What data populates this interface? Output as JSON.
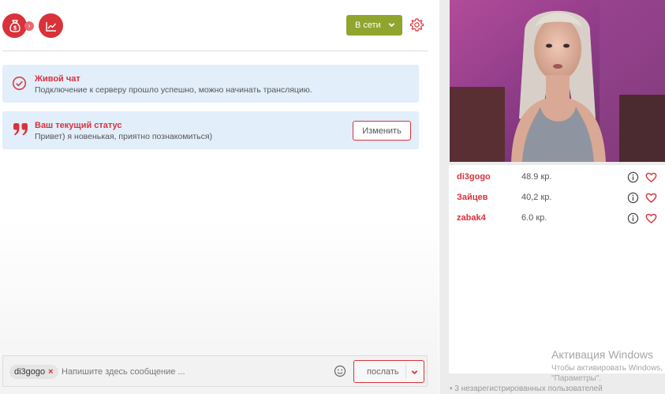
{
  "toolbar": {
    "earnings_icon": "money-bag-icon",
    "stats_icon": "trend-chart-icon",
    "status_select": {
      "value": "В сети"
    },
    "settings_icon": "gear-icon"
  },
  "notices": {
    "live_chat": {
      "title": "Живой чат",
      "text": "Подключение к серверу прошло успешно, можно начинать трансляцию."
    },
    "current_status": {
      "title": "Ваш текущий статус",
      "text": "Привет) я новенькая, приятно познакомиться)",
      "change_label": "Изменить"
    }
  },
  "composer": {
    "recipient_tag": "di3gogo",
    "placeholder": "Напишите здесь сообщение ...",
    "send_label": "послать"
  },
  "users": [
    {
      "name": "di3gogo",
      "credits": "48.9 кр."
    },
    {
      "name": "Зайцев",
      "credits": "40,2 кр."
    },
    {
      "name": "zabak4",
      "credits": "6.0 кр."
    }
  ],
  "footer": {
    "unregistered": "• 3 незарегистрированных пользователей"
  },
  "os_watermark": {
    "title": "Активация Windows",
    "line1": "Чтобы активировать Windows,",
    "line2": "\"Параметры\"."
  },
  "colors": {
    "accent": "#d9323a",
    "online": "#8fa52d",
    "notice_bg": "#e2eefa"
  }
}
